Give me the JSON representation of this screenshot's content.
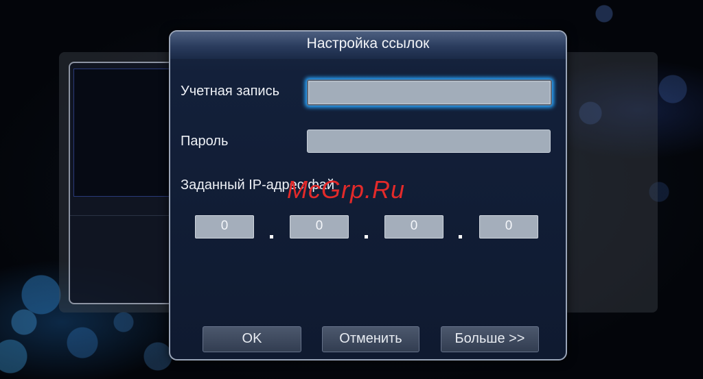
{
  "dialog": {
    "title": "Настройка ссылок",
    "account_label": "Учетная запись",
    "account_value": "",
    "password_label": "Пароль",
    "password_value": "",
    "ip_label": "Заданный IP-адрес фай",
    "ip_octets": [
      "0",
      "0",
      "0",
      "0"
    ],
    "buttons": {
      "ok": "OK",
      "cancel": "Отменить",
      "more": "Больше >>"
    }
  },
  "watermark": "McGrp.Ru",
  "colors": {
    "focus_glow": "#2aa6ff",
    "field_bg": "#a2adba",
    "dialog_bg": "#13203a",
    "watermark": "#e32a2a"
  }
}
